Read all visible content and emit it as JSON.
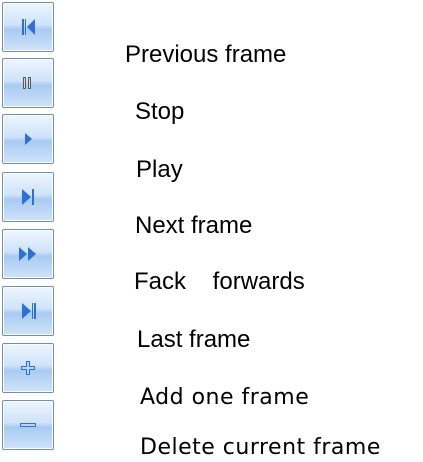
{
  "legend": {
    "items": [
      {
        "icon": "skip-to-start-icon",
        "label": "Previous frame"
      },
      {
        "icon": "pause-icon",
        "label": "Stop"
      },
      {
        "icon": "play-icon",
        "label": "Play"
      },
      {
        "icon": "step-forward-icon",
        "label": "Next frame"
      },
      {
        "icon": "fast-forward-icon",
        "label": "Fack    forwards"
      },
      {
        "icon": "skip-to-end-icon",
        "label": "Last frame"
      },
      {
        "icon": "plus-icon",
        "label": "Add one frame"
      },
      {
        "icon": "minus-icon",
        "label": "Delete current frame"
      }
    ]
  },
  "colors": {
    "button_border": "#6f8fb8",
    "button_face": "#cfe3fa",
    "icon_fill": "#2f6fd6",
    "icon_light": "#b9d6f7"
  }
}
